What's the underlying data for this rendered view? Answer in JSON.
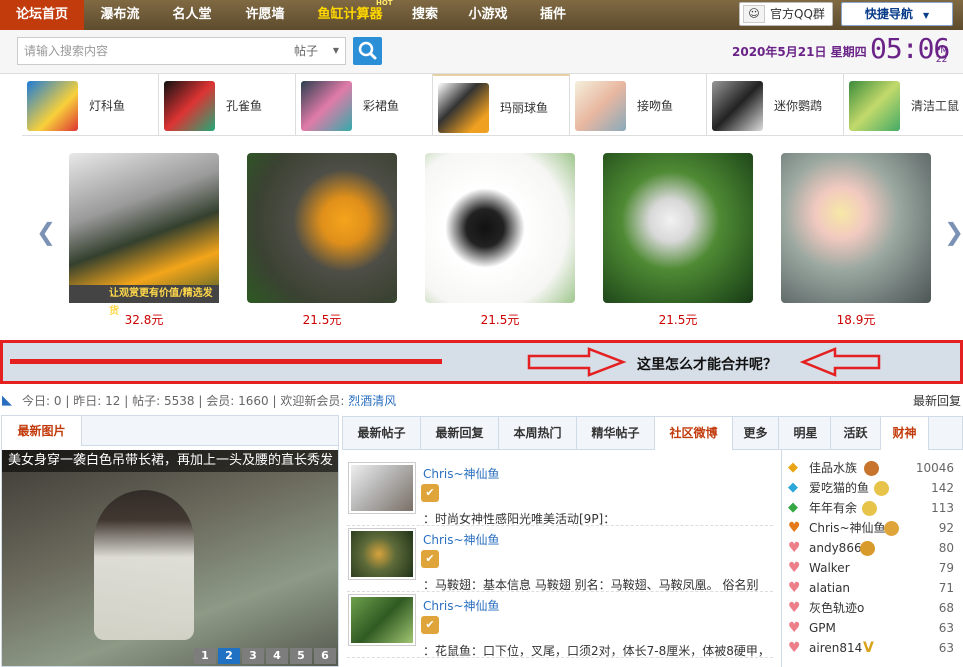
{
  "nav": {
    "items": [
      "论坛首页",
      "瀑布流",
      "名人堂",
      "许愿墙",
      "鱼缸计算器",
      "搜索",
      "小游戏",
      "插件"
    ],
    "hot_badge": "HOT",
    "qq_group": "官方QQ群",
    "quick_nav": "快捷导航"
  },
  "search": {
    "placeholder": "请输入搜索内容",
    "scope": "帖子"
  },
  "datetime": {
    "date": "2020年5月21日 星期四",
    "time": "05:06",
    "ampm": "PM",
    "seconds": "22"
  },
  "fish_tabs": [
    "灯科鱼",
    "孔雀鱼",
    "彩裙鱼",
    "玛丽球鱼",
    "接吻鱼",
    "迷你鹦鹉",
    "清洁工鼠"
  ],
  "products": [
    {
      "price": "32.8元",
      "caption": "让观赏更有价值/精选发货"
    },
    {
      "price": "21.5元"
    },
    {
      "price": "21.5元"
    },
    {
      "price": "21.5元"
    },
    {
      "price": "18.9元"
    }
  ],
  "banner": {
    "text": "这里怎么才能合并呢？"
  },
  "stats": {
    "today_label": "今日:",
    "today": "0",
    "yesterday_label": "昨日:",
    "yesterday": "12",
    "posts_label": "帖子:",
    "posts": "5538",
    "members_label": "会员:",
    "members": "1660",
    "welcome_label": "欢迎新会员:",
    "new_member": "烈酒清风",
    "latest_reply": "最新回复"
  },
  "left": {
    "tab": "最新图片",
    "feature_title": "美女身穿一袭白色吊带长裙，再加上一头及腰的直长秀发",
    "pages": [
      "1",
      "2",
      "3",
      "4",
      "5",
      "6"
    ]
  },
  "mid_tabs": [
    "最新帖子",
    "最新回复",
    "本周热门",
    "精华帖子",
    "社区微博",
    "更多",
    "明星",
    "活跃",
    "财神"
  ],
  "posts": [
    {
      "author": "Chris~神仙鱼",
      "text": "：时尚女神性感阳光唯美活动[9P]："
    },
    {
      "author": "Chris~神仙鱼",
      "text": "：马鞍翅：基本信息 马鞍翅 别名：马鞍翅、马鞍凤凰。 俗名别"
    },
    {
      "author": "Chris~神仙鱼",
      "text": "：花鼠鱼：口下位，叉尾，口须2对，体长7-8厘米，体被8硬甲，"
    }
  ],
  "ranking": [
    {
      "name": "佳品水族",
      "value": "10046"
    },
    {
      "name": "爱吃猫的鱼",
      "value": "142"
    },
    {
      "name": "年年有余",
      "value": "113"
    },
    {
      "name": "Chris~神仙鱼",
      "value": "92"
    },
    {
      "name": "andy866",
      "value": "80"
    },
    {
      "name": "Walker",
      "value": "79"
    },
    {
      "name": "alatian",
      "value": "71"
    },
    {
      "name": "灰色轨迹o",
      "value": "68"
    },
    {
      "name": "GPM",
      "value": "63"
    },
    {
      "name": "airen814",
      "value": "63"
    }
  ]
}
